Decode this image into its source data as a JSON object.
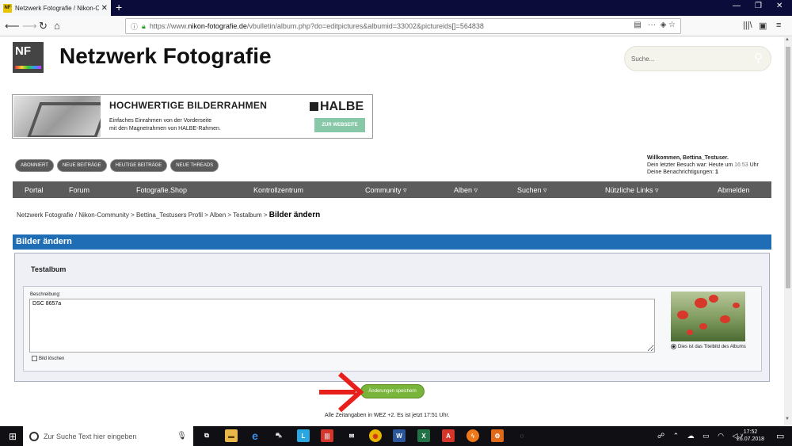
{
  "browser": {
    "tab_title": "Netzwerk Fotografie / Nikon-C",
    "tab_favicon": "NF",
    "url_prefix": "https://www.",
    "url_domain": "nikon-fotografie.de",
    "url_path": "/vbulletin/album.php?do=editpictures&albumid=33002&pictureids[]=564838"
  },
  "site": {
    "title": "Netzwerk Fotografie",
    "logo_text": "NF",
    "search_placeholder": "Suche..."
  },
  "ad": {
    "headline": "HOCHWERTIGE BILDERRAHMEN",
    "line1": "Einfaches Einrahmen von der Vorderseite",
    "line2": "mit den Magnetrahmen von HALBE-Rahmen.",
    "brand": "HALBE",
    "cta": "ZUR WEBSEITE"
  },
  "pills": [
    "ABONNIERT",
    "NEUE BEITRÄGE",
    "HEUTIGE BEITRÄGE",
    "NEUE THREADS"
  ],
  "welcome": {
    "line1": "Willkommen, Bettina_Testuser.",
    "line2_prefix": "Dein letzter Besuch war: Heute um ",
    "line2_time": "16:53",
    "line2_suffix": " Uhr",
    "line3_prefix": "Deine Benachrichtigungen: ",
    "line3_count": "1"
  },
  "nav": [
    "Portal",
    "Forum",
    "Fotografie.Shop",
    "Kontrollzentrum",
    "Community",
    "Alben",
    "Suchen",
    "Nützliche Links",
    "Abmelden"
  ],
  "breadcrumb": {
    "items": [
      "Netzwerk Fotografie / Nikon-Community",
      "Bettina_Testusers Profil",
      "Alben",
      "Testalbum"
    ],
    "sep": ">",
    "current": "Bilder ändern"
  },
  "section_title": "Bilder ändern",
  "album": {
    "title": "Testalbum",
    "description_label": "Beschreibung:",
    "description_value": "DSC 8657a",
    "delete_label": "Bild löschen",
    "cover_label": "Dies ist das Titelbild des Albums"
  },
  "save_button": "Änderungen speichern",
  "footer": "Alle Zeitangaben in WEZ +2. Es ist jetzt 17:51 Uhr.",
  "taskbar": {
    "search_placeholder": "Zur Suche Text hier eingeben",
    "time": "17:52",
    "date": "26.07.2018"
  },
  "colors": {
    "section_bar": "#1f6eb5",
    "save_button": "#79b53a",
    "nav_bg": "#5c5c5c",
    "annotation_arrow": "#e8201c"
  }
}
